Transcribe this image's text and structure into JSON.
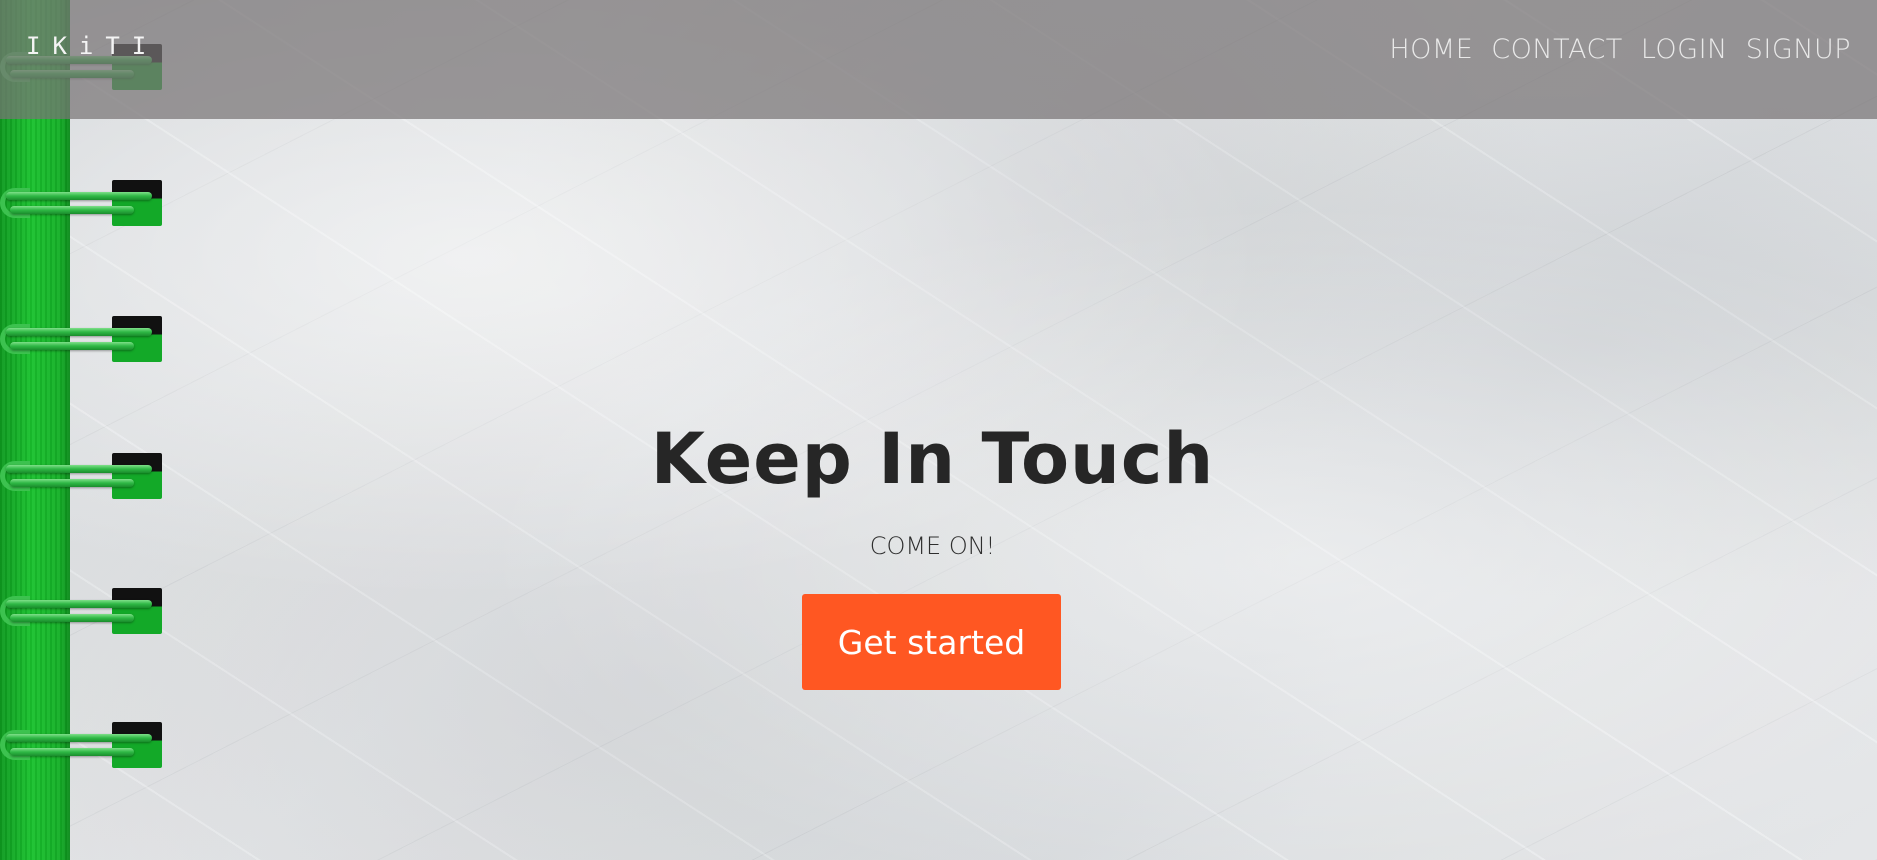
{
  "brand": {
    "name": "IKiTI"
  },
  "nav": {
    "items": [
      {
        "label": "HOME"
      },
      {
        "label": "CONTACT"
      },
      {
        "label": "LOGIN"
      },
      {
        "label": "SIGNUP"
      }
    ]
  },
  "hero": {
    "title": "Keep In Touch",
    "subtitle": "COME ON!",
    "cta_label": "Get started"
  },
  "colors": {
    "accent": "#ff5722",
    "binding_green": "#19c22e",
    "header_overlay": "#787476"
  }
}
